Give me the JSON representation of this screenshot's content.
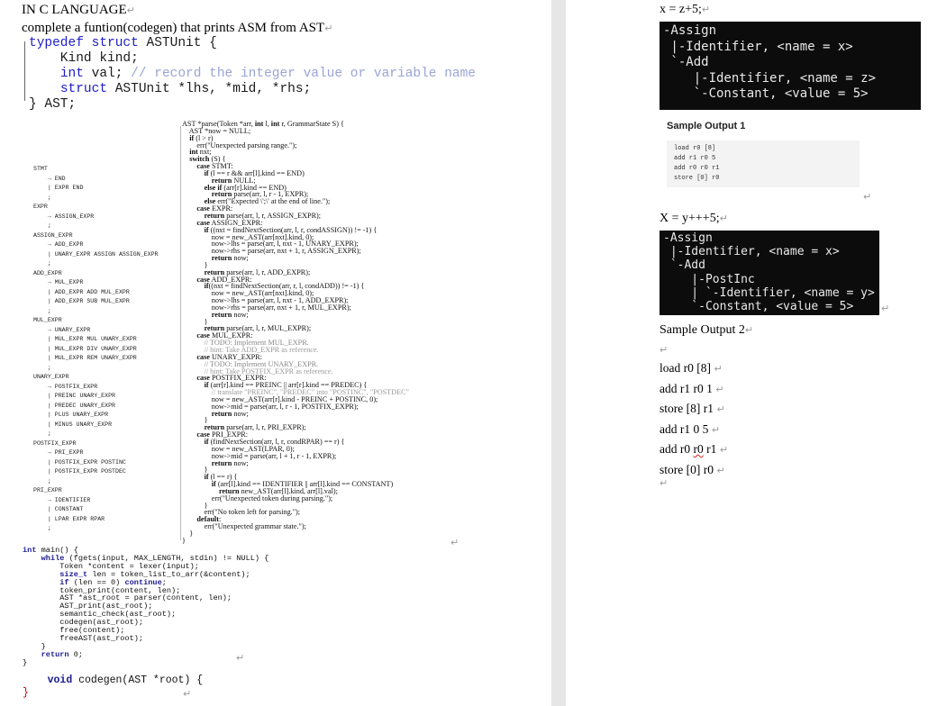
{
  "left": {
    "title": "IN C LANGUAGE",
    "instruction": "complete a funtion(codegen) that prints ASM from AST",
    "struct_lines": [
      {
        "pre": "",
        "kw": "typedef struct",
        "post": " ASTUnit {",
        "cm": ""
      },
      {
        "pre": "    Kind kind;",
        "kw": "",
        "post": "",
        "cm": ""
      },
      {
        "pre": "    ",
        "kw": "int",
        "post": " val; ",
        "cm": "// record the integer value or variable name"
      },
      {
        "pre": "    ",
        "kw": "struct",
        "post": " ASTUnit *lhs, *mid, *rhs;",
        "cm": ""
      },
      {
        "pre": "} AST;",
        "kw": "",
        "post": "",
        "cm": ""
      }
    ],
    "grammar": [
      "STMT",
      "    → END",
      "    | EXPR END",
      "    ;",
      "EXPR",
      "    → ASSIGN_EXPR",
      "    ;",
      "ASSIGN_EXPR",
      "    → ADD_EXPR",
      "    | UNARY_EXPR ASSIGN ASSIGN_EXPR",
      "    ;",
      "ADD_EXPR",
      "    → MUL_EXPR",
      "    | ADD_EXPR ADD MUL_EXPR",
      "    | ADD_EXPR SUB MUL_EXPR",
      "    ;",
      "MUL_EXPR",
      "    → UNARY_EXPR",
      "    | MUL_EXPR MUL UNARY_EXPR",
      "    | MUL_EXPR DIV UNARY_EXPR",
      "    | MUL_EXPR REM UNARY_EXPR",
      "    ;",
      "UNARY_EXPR",
      "    → POSTFIX_EXPR",
      "    | PREINC UNARY_EXPR",
      "    | PREDEC UNARY_EXPR",
      "    | PLUS UNARY_EXPR",
      "    | MINUS UNARY_EXPR",
      "    ;",
      "POSTFIX_EXPR",
      "    → PRI_EXPR",
      "    | POSTFIX_EXPR POSTINC",
      "    | POSTFIX_EXPR POSTDEC",
      "    ;",
      "PRI_EXPR",
      "    → IDENTIFIER",
      "    | CONSTANT",
      "    | LPAR EXPR RPAR",
      "    ;"
    ],
    "parse_code": [
      "AST *parse(Token *arr, int l, int r, GrammarState S) {",
      "    AST *now = NULL;",
      "    if (l > r)",
      "        err(\"Unexpected parsing range.\");",
      "    int nxt;",
      "    switch (S) {",
      "        case STMT:",
      "            if (l == r && arr[l].kind == END)",
      "                return NULL;",
      "            else if (arr[r].kind == END)",
      "                return parse(arr, l, r - 1, EXPR);",
      "            else err(\"Expected \\';\\' at the end of line.\");",
      "        case EXPR:",
      "            return parse(arr, l, r, ASSIGN_EXPR);",
      "        case ASSIGN_EXPR:",
      "            if ((nxt = findNextSection(arr, l, r, condASSIGN)) != -1) {",
      "                now = new_AST(arr[nxt].kind, 0);",
      "                now->lhs = parse(arr, l, nxt - 1, UNARY_EXPR);",
      "                now->rhs = parse(arr, nxt + 1, r, ASSIGN_EXPR);",
      "                return now;",
      "            }",
      "            return parse(arr, l, r, ADD_EXPR);",
      "        case ADD_EXPR:",
      "            if((nxt = findNextSection(arr, r, l, condADD)) != -1) {",
      "                now = new_AST(arr[nxt].kind, 0);",
      "                now->lhs = parse(arr, l, nxt - 1, ADD_EXPR);",
      "                now->rhs = parse(arr, nxt + 1, r, MUL_EXPR);",
      "                return now;",
      "            }",
      "            return parse(arr, l, r, MUL_EXPR);",
      "        case MUL_EXPR:",
      "            // TODO: Implement MUL_EXPR.",
      "            // hint: Take ADD_EXPR as reference.",
      "        case UNARY_EXPR:",
      "            // TODO: Implement UNARY_EXPR.",
      "            // hint: Take POSTFIX_EXPR as reference.",
      "        case POSTFIX_EXPR:",
      "            if (arr[r].kind == PREINC || arr[r].kind == PREDEC) {",
      "                // translate \"PREINC\", \"PREDEC\" into \"POSTINC\", \"POSTDEC\"",
      "                now = new_AST(arr[r].kind - PREINC + POSTINC, 0);",
      "                now->mid = parse(arr, l, r - 1, POSTFIX_EXPR);",
      "                return now;",
      "            }",
      "            return parse(arr, l, r, PRI_EXPR);",
      "        case PRI_EXPR:",
      "            if (findNextSection(arr, l, r, condRPAR) == r) {",
      "                now = new_AST(LPAR, 0);",
      "                now->mid = parse(arr, l + 1, r - 1, EXPR);",
      "                return now;",
      "            }",
      "            if (l == r) {",
      "                if (arr[l].kind == IDENTIFIER || arr[l].kind == CONSTANT)",
      "                    return new_AST(arr[l].kind, arr[l].val);",
      "                err(\"Unexpected token during parsing.\");",
      "            }",
      "            err(\"No token left for parsing.\");",
      "        default:",
      "            err(\"Unexpected grammar state.\");",
      "    }",
      "}"
    ],
    "main_code": [
      "int main() {",
      "    while (fgets(input, MAX_LENGTH, stdin) != NULL) {",
      "        Token *content = lexer(input);",
      "        size_t len = token_list_to_arr(&content);",
      "        if (len == 0) continue;",
      "        token_print(content, len);",
      "        AST *ast_root = parser(content, len);",
      "        AST_print(ast_root);",
      "        semantic_check(ast_root);",
      "        codegen(ast_root);",
      "        free(content);",
      "        freeAST(ast_root);",
      "    }",
      "    return 0;",
      "}"
    ],
    "codegen_sig": "void codegen(AST *root) {",
    "codegen_close": "}"
  },
  "right": {
    "example1_expr": "x = z+5;",
    "example1_tree": [
      "-Assign",
      " |-Identifier, <name = x>",
      " `-Add",
      "    |-Identifier, <name = z>",
      "    `-Constant, <value = 5>"
    ],
    "sample1_label": "Sample Output 1",
    "sample1_lines": [
      "load r0 [8]",
      "add r1 r0 5",
      "add r0 r0 r1",
      "store [0] r0"
    ],
    "example2_expr": "X = y+++5;",
    "example2_tree": [
      "-Assign",
      " |-Identifier, <name = x>",
      " `-Add",
      "    |-PostInc",
      "    | `-Identifier, <name = y>",
      "    `-Constant, <value = 5>"
    ],
    "sample2_label": "Sample Output 2",
    "sample2_lines": [
      "load r0 [8]",
      "add r1 r0 1",
      "store [8] r1",
      "add r1 0 5",
      "add r0 r0 r1",
      "store [0] r0"
    ]
  },
  "marks": {
    "paragraph": "↵"
  }
}
